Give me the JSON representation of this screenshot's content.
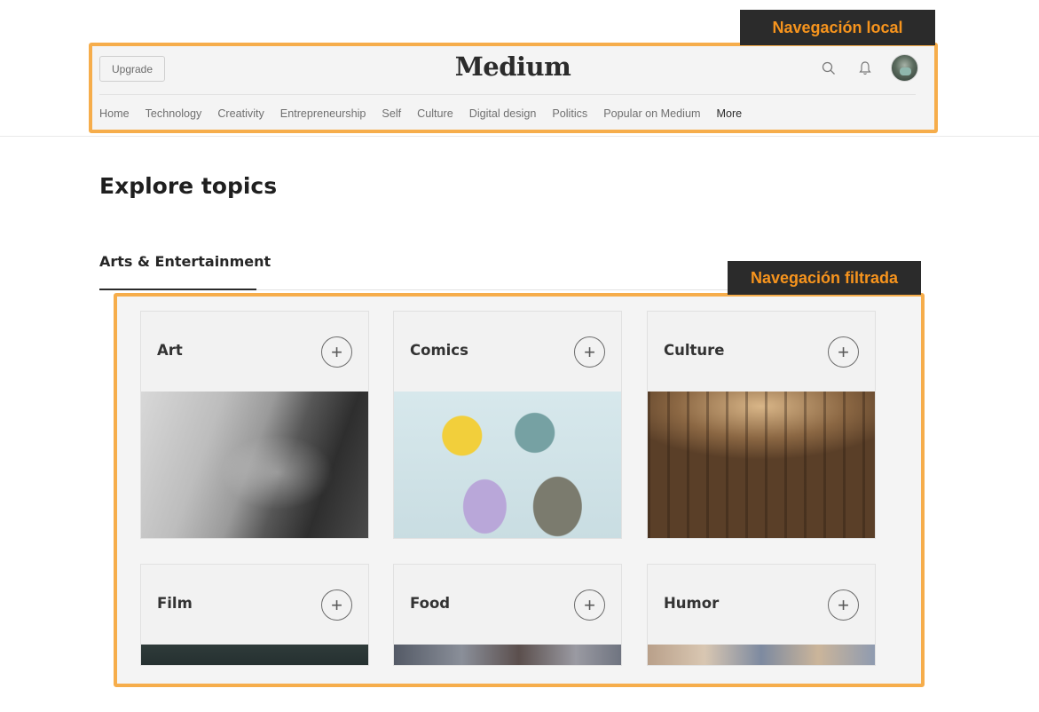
{
  "annotations": {
    "local_nav_label": "Navegación local",
    "filtered_nav_label": "Navegación filtrada",
    "accent_color": "#f6ad4b",
    "label_text_color": "#f7941d"
  },
  "header": {
    "upgrade_label": "Upgrade",
    "logo": "Medium",
    "icons": [
      "search-icon",
      "bell-icon"
    ],
    "nav": {
      "items": [
        "Home",
        "Technology",
        "Creativity",
        "Entrepreneurship",
        "Self",
        "Culture",
        "Digital design",
        "Politics",
        "Popular on Medium"
      ],
      "more_label": "More"
    }
  },
  "main": {
    "title": "Explore topics",
    "section_tab": "Arts & Entertainment",
    "topics": [
      {
        "name": "Art",
        "follow_symbol": "+"
      },
      {
        "name": "Comics",
        "follow_symbol": "+"
      },
      {
        "name": "Culture",
        "follow_symbol": "+"
      },
      {
        "name": "Film",
        "follow_symbol": "+"
      },
      {
        "name": "Food",
        "follow_symbol": "+"
      },
      {
        "name": "Humor",
        "follow_symbol": "+"
      }
    ]
  }
}
